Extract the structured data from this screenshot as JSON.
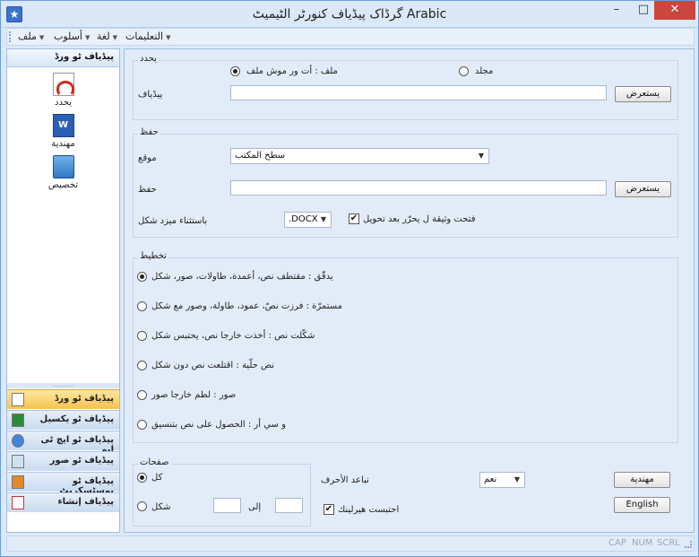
{
  "window": {
    "title": "گرڈاک پیڈیاف کنورٹر الٹیمیٹ Arabic",
    "min": "–",
    "max": "□",
    "close": "✕",
    "app_icon": "star-icon"
  },
  "menu": {
    "items": [
      "التعليمات",
      "لغة",
      "أسلوب",
      "ملف"
    ]
  },
  "sidebar": {
    "header": "پیڈیاف ٹو ورڈ",
    "items": [
      {
        "label": "يحدد",
        "icon": "pdf-icon"
      },
      {
        "label": "مهندية",
        "icon": "word-doc-icon"
      },
      {
        "label": "تخصيص",
        "icon": "computer-icon"
      }
    ],
    "nav": [
      "پیڈیاف ٹو ورڈ",
      "پیڈیاف ٹو یکسیل",
      "پیڈیاف ٹو ایچ ٹی ایم",
      "پیڈیاف ٹو صور",
      "پیڈیاف ٹو بوسٹسکریٹ",
      "پیڈیاف إنشاء"
    ]
  },
  "select_group": {
    "label": "يحدد",
    "file_label": "ملف : أت ور موش ملف",
    "folder_label": "مجلد",
    "pdf_label": "پیڈیاف",
    "browse": "يستعرض",
    "pdf_value": ""
  },
  "save_group": {
    "label": "حفظ",
    "location_label": "موقع",
    "location_value": "سطح المكتب",
    "save_label": "حفظ",
    "browse": "يستعرض",
    "save_value": "",
    "format_label": "باستثناء ميزد شكل",
    "format_value": ".DOCX",
    "open_after_label": "فتحت وثيقة ل يحرّر بعد تحويل"
  },
  "layout_group": {
    "label": "تخطيط",
    "options": [
      {
        "name": "يدقّق",
        "desc": "مقتطف نص، أعمدة، طاولات، صور، شكل"
      },
      {
        "name": "مستمرّة",
        "desc": "فرزت نصّ، عمود، طاولة، وصور مع شكل"
      },
      {
        "name": "شكّلت نص",
        "desc": "أخذت خارجا نص، يحتبس شكل"
      },
      {
        "name": "نص حلّية",
        "desc": "اقتلعت نص دون شكل"
      },
      {
        "name": "صور",
        "desc": "لطم خارجا صور"
      },
      {
        "name": "و سي أر",
        "desc": "الحصول على نص بتنسيق"
      }
    ]
  },
  "pages_group": {
    "label": "صفحات",
    "all": "كل",
    "range": "شكل",
    "to": "إلى",
    "from_value": "",
    "to_value": ""
  },
  "options": {
    "spacing_label": "تباعد الأحرف",
    "spacing_value": "نعم",
    "hyperlink_label": "احتبست هيرلينك",
    "mohandia_button": "مهندية",
    "english_button": "English"
  },
  "status": {
    "cap": "CAP",
    "num": "NUM",
    "scrl": "SCRL"
  }
}
